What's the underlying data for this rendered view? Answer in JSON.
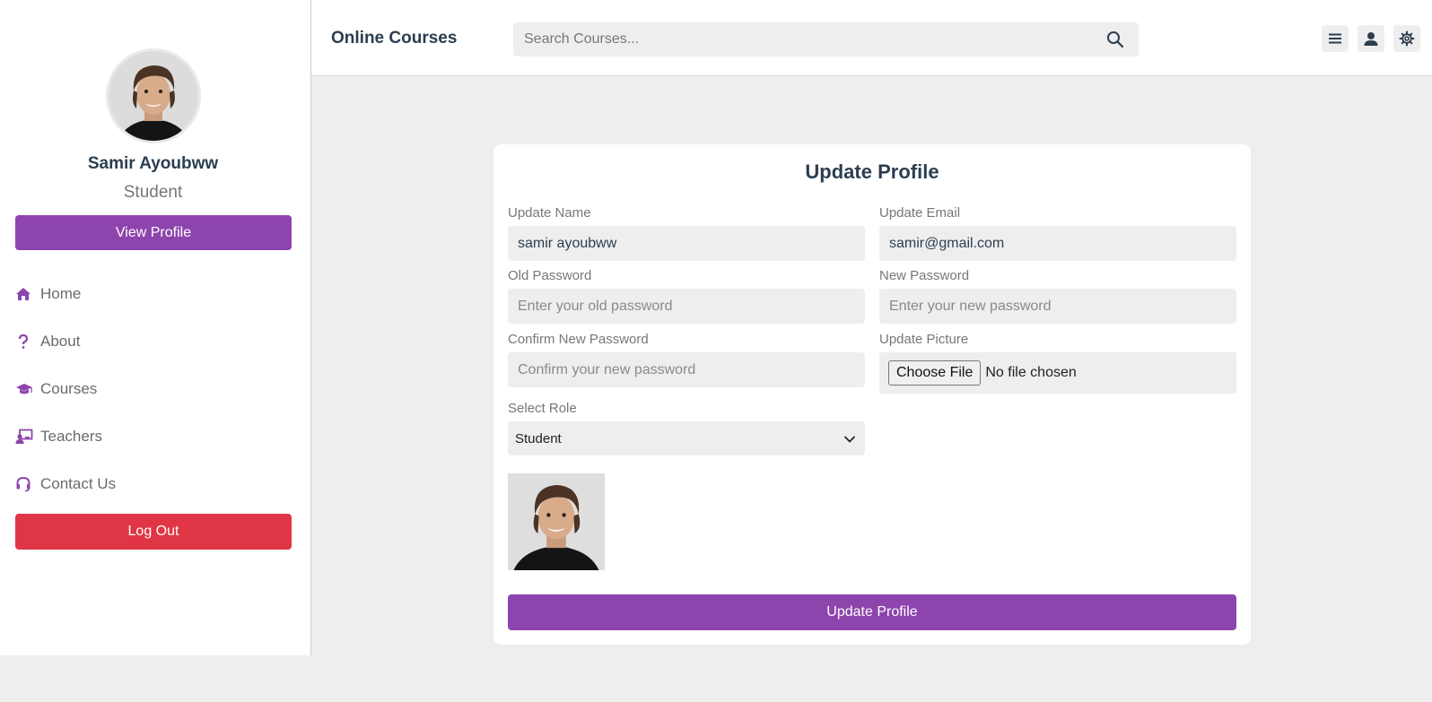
{
  "sidebar": {
    "user_name": "Samir Ayoubww",
    "user_role": "Student",
    "view_profile_label": "View Profile",
    "nav": [
      {
        "label": "Home",
        "icon": "home-icon"
      },
      {
        "label": "About",
        "icon": "question-icon"
      },
      {
        "label": "Courses",
        "icon": "graduation-cap-icon"
      },
      {
        "label": "Teachers",
        "icon": "teacher-icon"
      },
      {
        "label": "Contact Us",
        "icon": "headset-icon"
      }
    ],
    "logout_label": "Log Out"
  },
  "header": {
    "brand": "Online Courses",
    "search_placeholder": "Search Courses...",
    "icons": [
      "menu-icon",
      "user-icon",
      "settings-icon"
    ]
  },
  "form": {
    "title": "Update Profile",
    "name_label": "Update Name",
    "name_value": "samir ayoubww",
    "email_label": "Update Email",
    "email_value": "samir@gmail.com",
    "old_password_label": "Old Password",
    "old_password_placeholder": "Enter your old password",
    "new_password_label": "New Password",
    "new_password_placeholder": "Enter your new password",
    "confirm_password_label": "Confirm New Password",
    "confirm_password_placeholder": "Confirm your new password",
    "picture_label": "Update Picture",
    "choose_file_label": "Choose File",
    "no_file_text": "No file chosen",
    "role_label": "Select Role",
    "role_value": "Student",
    "submit_label": "Update Profile"
  },
  "colors": {
    "accent": "#8e44ad",
    "danger": "#e03545",
    "background": "#eeeeee",
    "text_dark": "#2c3e50"
  }
}
